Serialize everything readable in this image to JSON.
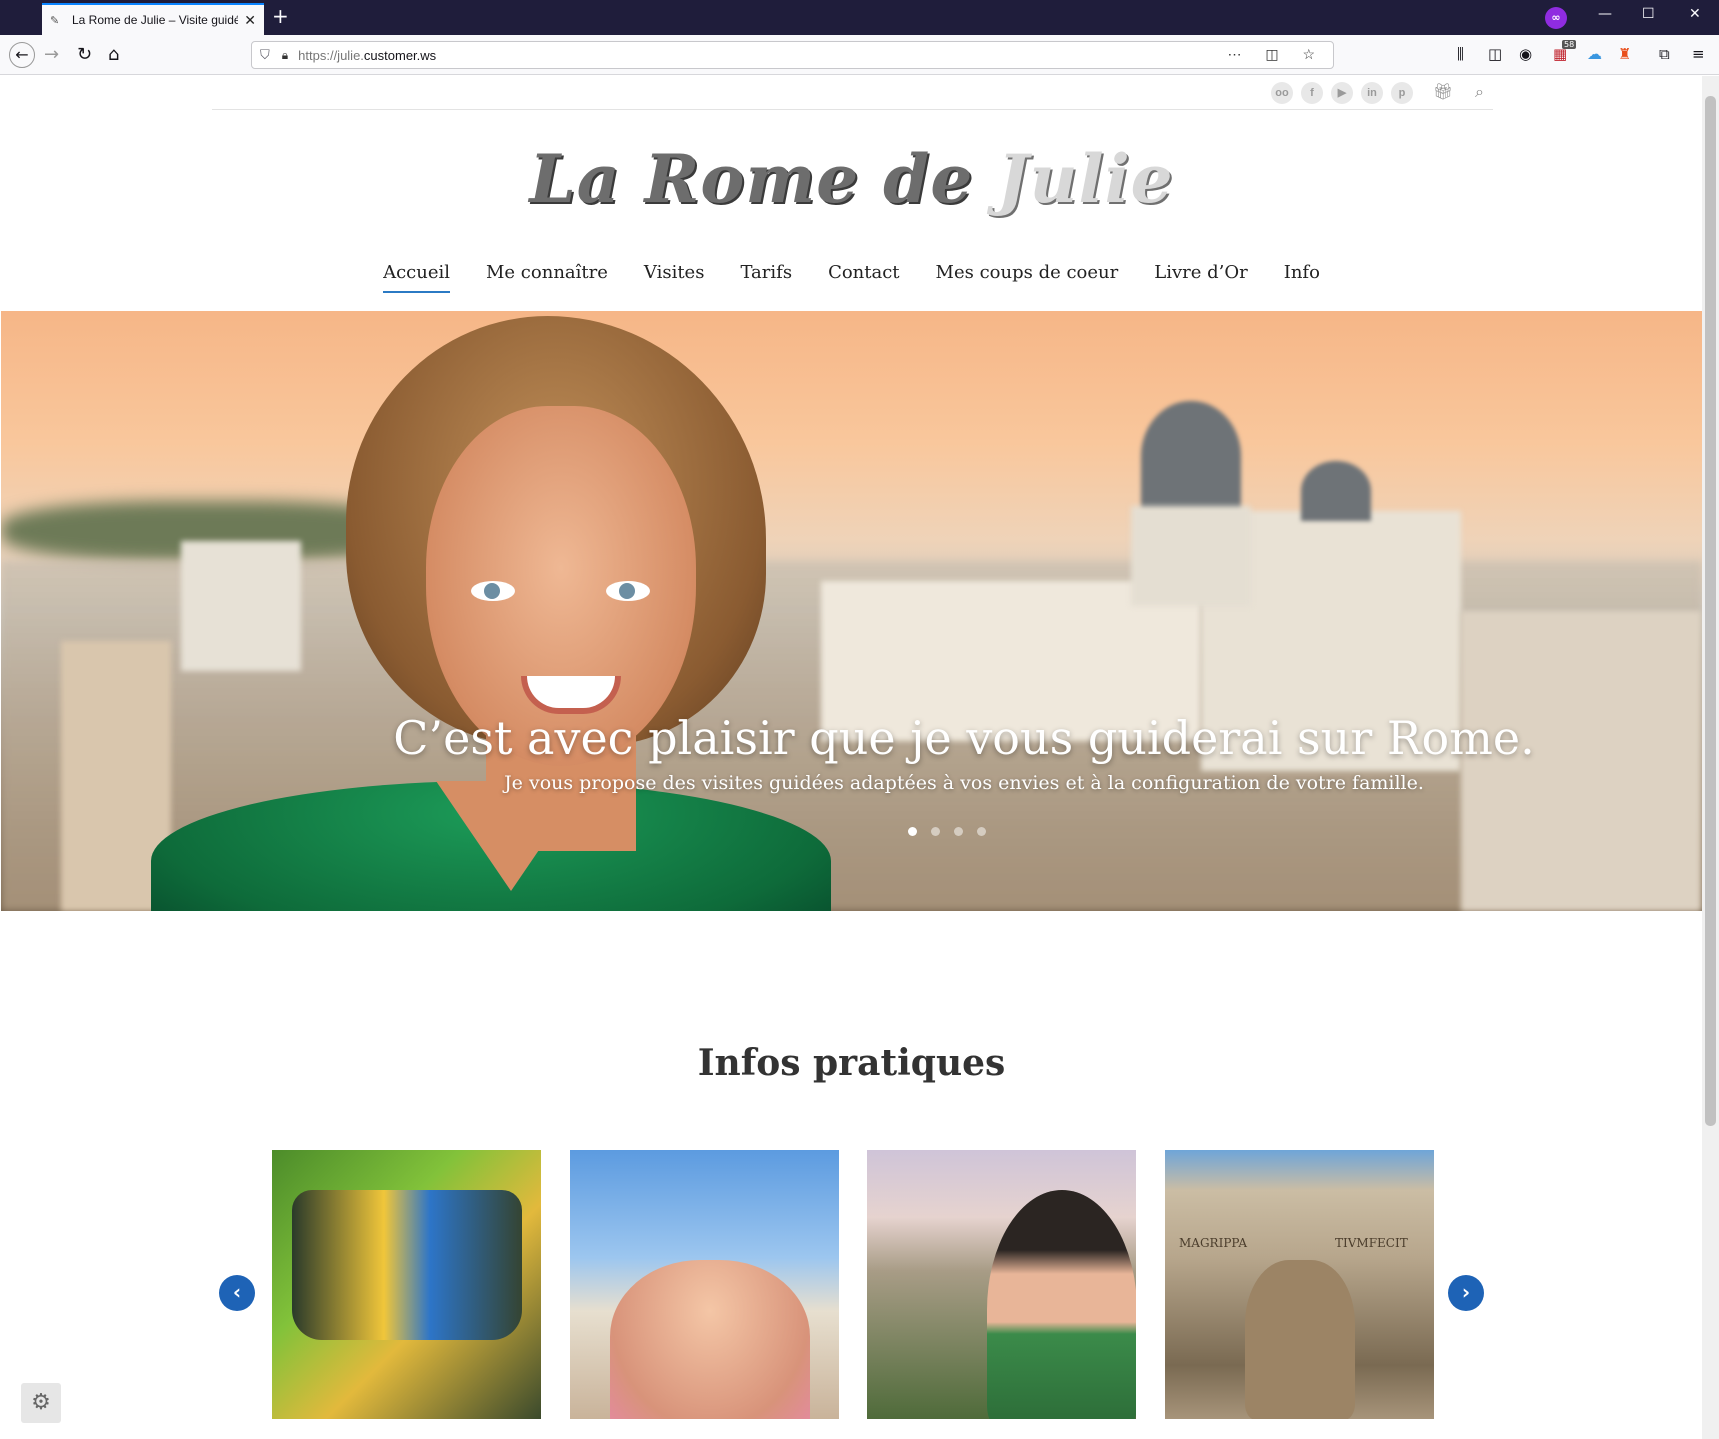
{
  "browser": {
    "tab_title": "La Rome de Julie – Visite guidé",
    "url_scheme": "https://julie.",
    "url_host": "customer.ws",
    "badge_count": "58"
  },
  "header": {
    "logo_part1": "La Rome de ",
    "logo_part2": "Julie",
    "social_icons": [
      "tripadvisor-icon",
      "facebook-icon",
      "youtube-icon",
      "linkedin-icon",
      "pinterest-icon"
    ],
    "social_glyphs": [
      "oo",
      "f",
      "▶",
      "in",
      "p"
    ]
  },
  "menu": {
    "items": [
      "Accueil",
      "Me connaître",
      "Visites",
      "Tarifs",
      "Contact",
      "Mes coups de coeur",
      "Livre d’Or",
      "Info"
    ],
    "active": "Accueil"
  },
  "hero": {
    "title": "C’est avec plaisir que je vous guiderai sur Rome.",
    "subtitle": "Je vous propose des visites guidées adaptées à vos envies et à la configuration de votre famille.",
    "slides": 4,
    "active_slide": 1
  },
  "infos": {
    "title": "Infos pratiques",
    "pantheon_text_left": "MAGRIPPA",
    "pantheon_text_right": "TIVMFECIT"
  },
  "colors": {
    "accent": "#2b7ac4",
    "arrow": "#1e63b6",
    "browser_dark": "#1f1d3b"
  }
}
